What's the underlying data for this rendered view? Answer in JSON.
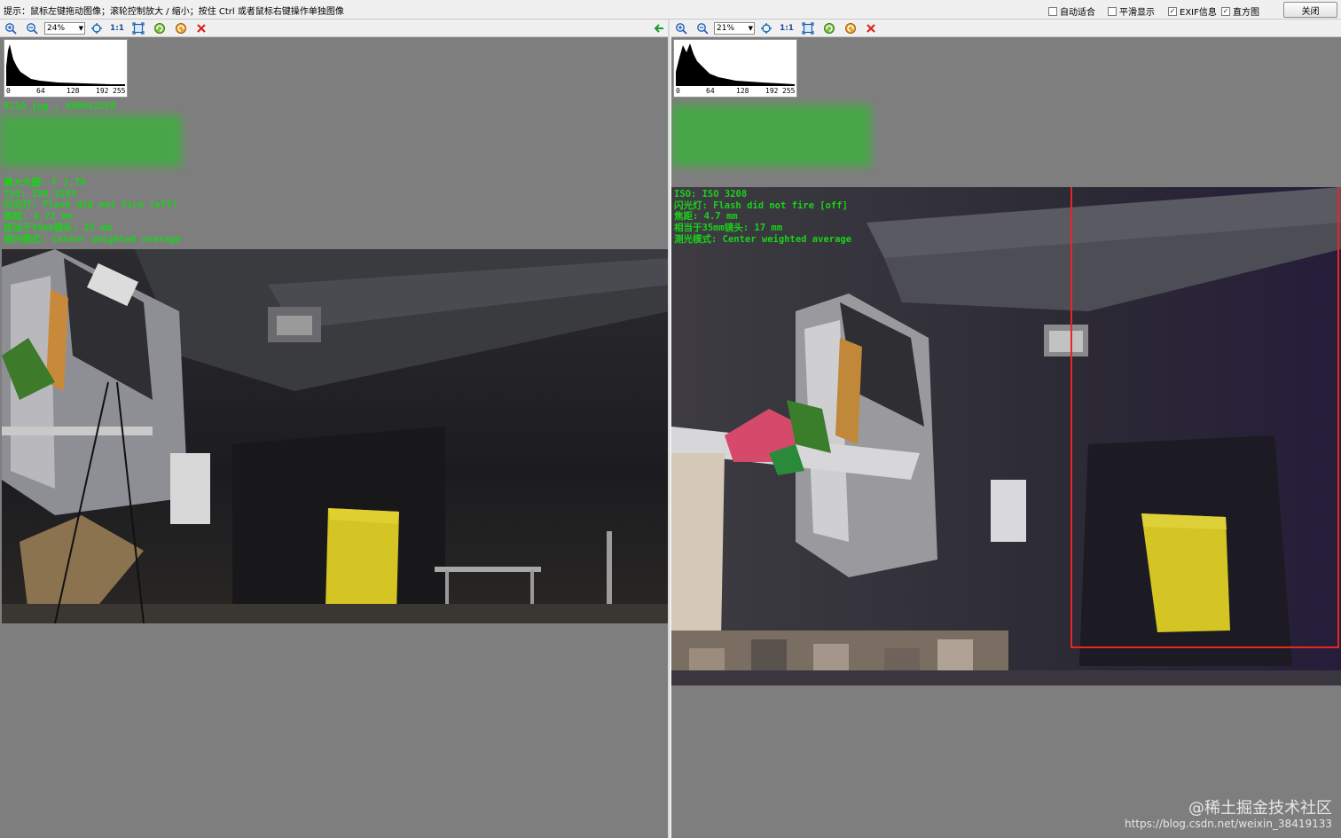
{
  "topbar": {
    "hint": "提示：鼠标左键拖动图像；滚轮控制放大 / 缩小；按住 Ctrl 或者鼠标右键操作单独图像",
    "options": [
      {
        "label": "自动适合",
        "checked": false
      },
      {
        "label": "平滑显示",
        "checked": false
      },
      {
        "label": "EXIF信息",
        "checked": true
      },
      {
        "label": "直方图",
        "checked": true
      }
    ],
    "close_label": "关闭"
  },
  "left": {
    "zoom": "24%",
    "one_to_one": "1:1",
    "histogram_ticks": [
      "0",
      "64",
      "128",
      "192",
      "255"
    ],
    "file_line": "K11A.jpg , 4000x2250",
    "exif_lines": [
      "最大光圈: F 1.78",
      "ISO: ISO 3203",
      "闪光灯: Flash did not fire [off]",
      "焦距: 4.71 mm",
      "相当于35mm镜头: 25 mm",
      "测光模式: Center weighted average"
    ]
  },
  "right": {
    "zoom": "21%",
    "one_to_one": "1:1",
    "histogram_ticks": [
      "0",
      "64",
      "128",
      "192",
      "255"
    ],
    "exif_lines": [
      "ISO: ISO 3208",
      "闪光灯: Flash did not fire [off]",
      "焦距: 4.7 mm",
      "相当于35mm镜头: 17 mm",
      "测光模式: Center weighted average"
    ]
  },
  "watermark": {
    "site": "@稀土掘金技术社区",
    "url": "https://blog.csdn.net/weixin_38419133"
  },
  "colors": {
    "exif_text": "#19d219",
    "highlight_box": "#e8261f",
    "pane_bg": "#7e7e7e",
    "yellow_board": "#d4c424"
  }
}
